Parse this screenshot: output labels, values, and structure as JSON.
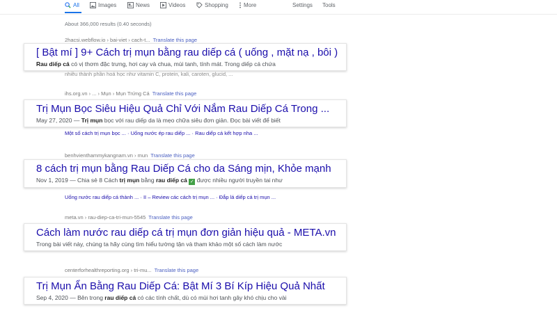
{
  "tabs": [
    {
      "label": "All",
      "icon": "search-icon",
      "active": true
    },
    {
      "label": "Images",
      "icon": "image-icon"
    },
    {
      "label": "News",
      "icon": "news-icon"
    },
    {
      "label": "Videos",
      "icon": "video-icon"
    },
    {
      "label": "Shopping",
      "icon": "tag-icon"
    },
    {
      "label": "More",
      "icon": "more-vert-icon"
    }
  ],
  "tools": {
    "settings": "Settings",
    "tools": "Tools"
  },
  "stats": "About 366,000 results (0.40 seconds)",
  "results": [
    {
      "cite": "2hacsi.webflow.io › bai-viet › cach-t...",
      "translate": "Translate this page",
      "title": "[ Bật mí ] 9+ Cách trị mụn bằng rau diếp cá ( uống , mặt nạ , bôi )",
      "snippet_bold": "Rau diếp cá",
      "snippet_rest": " có vị thơm đặc trưng, hơi cay và chua, mùi tanh, tính mát. Trong diếp cá chứa",
      "below": "nhiều thành phần hoá học như vitamin C, protein, kali, caroten, glucid, ..."
    },
    {
      "cite": "ihs.org.vn › ... › Mụn › Mụn Trứng Cá",
      "translate": "Translate this page",
      "title": "Trị Mụn Bọc Siêu Hiệu Quả Chỉ Với Nắm Rau Diếp Cá Trong ...",
      "snippet_pre": "May 27, 2020 — ",
      "snippet_bold": "Trị mụn",
      "snippet_rest": " bọc với rau diếp da là mẹo chữa siêu đơn giản. Đọc bài viết để biết",
      "sublinks": [
        "Một số cách trị mụn bọc ...",
        "Uống nước ép rau diếp ...",
        "Rau diếp cá kết hợp nha ..."
      ]
    },
    {
      "cite": "benhvienthammykangnam.vn › mun",
      "translate": "Translate this page",
      "title": "8 cách trị mụn bằng Rau Diếp Cá cho da Sáng mịn, Khỏe mạnh",
      "snippet_pre": "Nov 1, 2019 — Chia sẻ 8 Cách ",
      "snippet_bold": "trị mụn",
      "snippet_mid": " bằng ",
      "snippet_bold2": "rau diếp cá",
      "snippet_rest": " được nhiều người truyền tai như",
      "sublinks": [
        "Uống nước rau diếp cá thành ...",
        "II – Review các cách trị mụn ...",
        "Đắp lá diếp cá trị mụn ..."
      ]
    },
    {
      "cite": "meta.vn › rau-diep-ca-tri-mun-5545",
      "translate": "Translate this page",
      "title": "Cách làm nước rau diếp cá trị mụn đơn giản hiệu quả - META.vn",
      "snippet_rest": "Trong bài viết này, chúng ta hãy cùng tìm hiểu tường tận và tham khảo một số cách làm nước"
    },
    {
      "cite": "centerforhealthreporting.org › tri-mu...",
      "translate": "Translate this page",
      "title": "Trị Mụn Ẩn Bằng Rau Diếp Cá: Bật Mí 3 Bí Kíp Hiệu Quả Nhất",
      "snippet_pre": "Sep 4, 2020 — Bên trong ",
      "snippet_bold": "rau diếp cá",
      "snippet_rest": " có các tính chất, dù có mùi hơi tanh gây khó chịu cho vài"
    }
  ]
}
